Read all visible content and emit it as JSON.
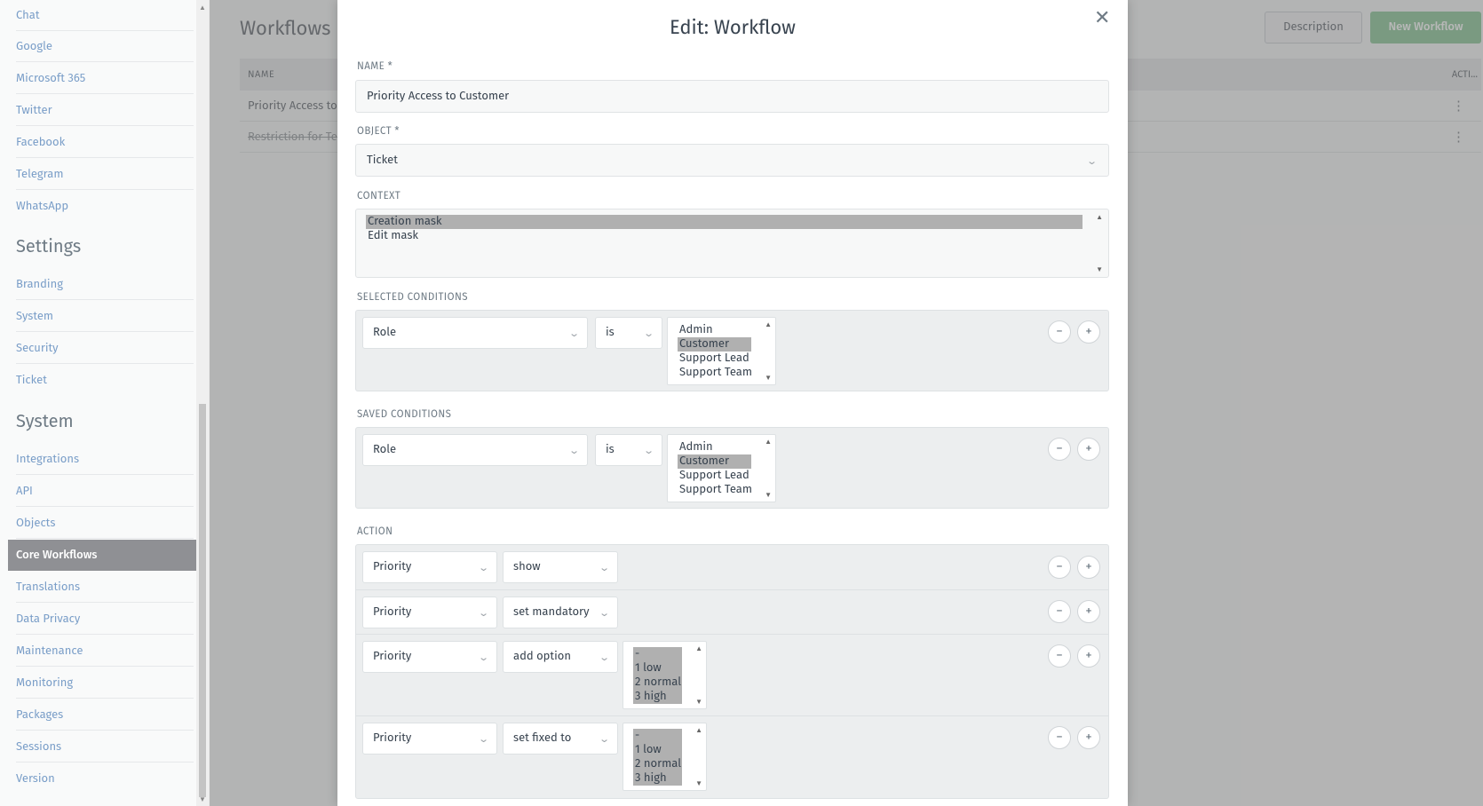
{
  "sidebar": {
    "items_top": [
      "Chat",
      "Google",
      "Microsoft 365",
      "Twitter",
      "Facebook",
      "Telegram",
      "WhatsApp"
    ],
    "settings_heading": "Settings",
    "settings_items": [
      "Branding",
      "System",
      "Security",
      "Ticket"
    ],
    "system_heading": "System",
    "system_items": [
      "Integrations",
      "API",
      "Objects",
      "Core Workflows",
      "Translations",
      "Data Privacy",
      "Maintenance",
      "Monitoring",
      "Packages",
      "Sessions",
      "Version"
    ],
    "active_item": "Core Workflows"
  },
  "main": {
    "title": "Workflows",
    "description_button": "Description",
    "new_button": "New Workflow",
    "table": {
      "col_name": "NAME",
      "col_actions": "ACTI...",
      "rows": [
        "Priority Access to",
        "Restriction for Te"
      ]
    }
  },
  "modal": {
    "title": "Edit: Workflow",
    "close_icon": "close-icon",
    "name_label": "NAME *",
    "name_value": "Priority Access to Customer",
    "object_label": "OBJECT *",
    "object_value": "Ticket",
    "context_label": "CONTEXT",
    "context_options": [
      "Creation mask",
      "Edit mask"
    ],
    "context_selected": "Creation mask",
    "selected_conditions_label": "SELECTED CONDITIONS",
    "selected_conditions": {
      "attribute": "Role",
      "operator": "is",
      "options": [
        "Admin",
        "Customer",
        "Support Lead",
        "Support Team"
      ],
      "selected": "Customer"
    },
    "saved_conditions_label": "SAVED CONDITIONS",
    "saved_conditions": {
      "attribute": "Role",
      "operator": "is",
      "options": [
        "Admin",
        "Customer",
        "Support Lead",
        "Support Team"
      ],
      "selected": "Customer"
    },
    "action_label": "ACTION",
    "actions": [
      {
        "attribute": "Priority",
        "operator": "show"
      },
      {
        "attribute": "Priority",
        "operator": "set mandatory"
      },
      {
        "attribute": "Priority",
        "operator": "add option",
        "options": [
          "-",
          "1 low",
          "2 normal",
          "3 high"
        ]
      },
      {
        "attribute": "Priority",
        "operator": "set fixed to",
        "options": [
          "-",
          "1 low",
          "2 normal",
          "3 high"
        ]
      }
    ],
    "remove_symbol": "−",
    "add_symbol": "+"
  },
  "colors": {
    "accent_green": "#a9d6b3",
    "active_nav_bg": "#8f9094",
    "link_blue": "#7a9ec8"
  }
}
